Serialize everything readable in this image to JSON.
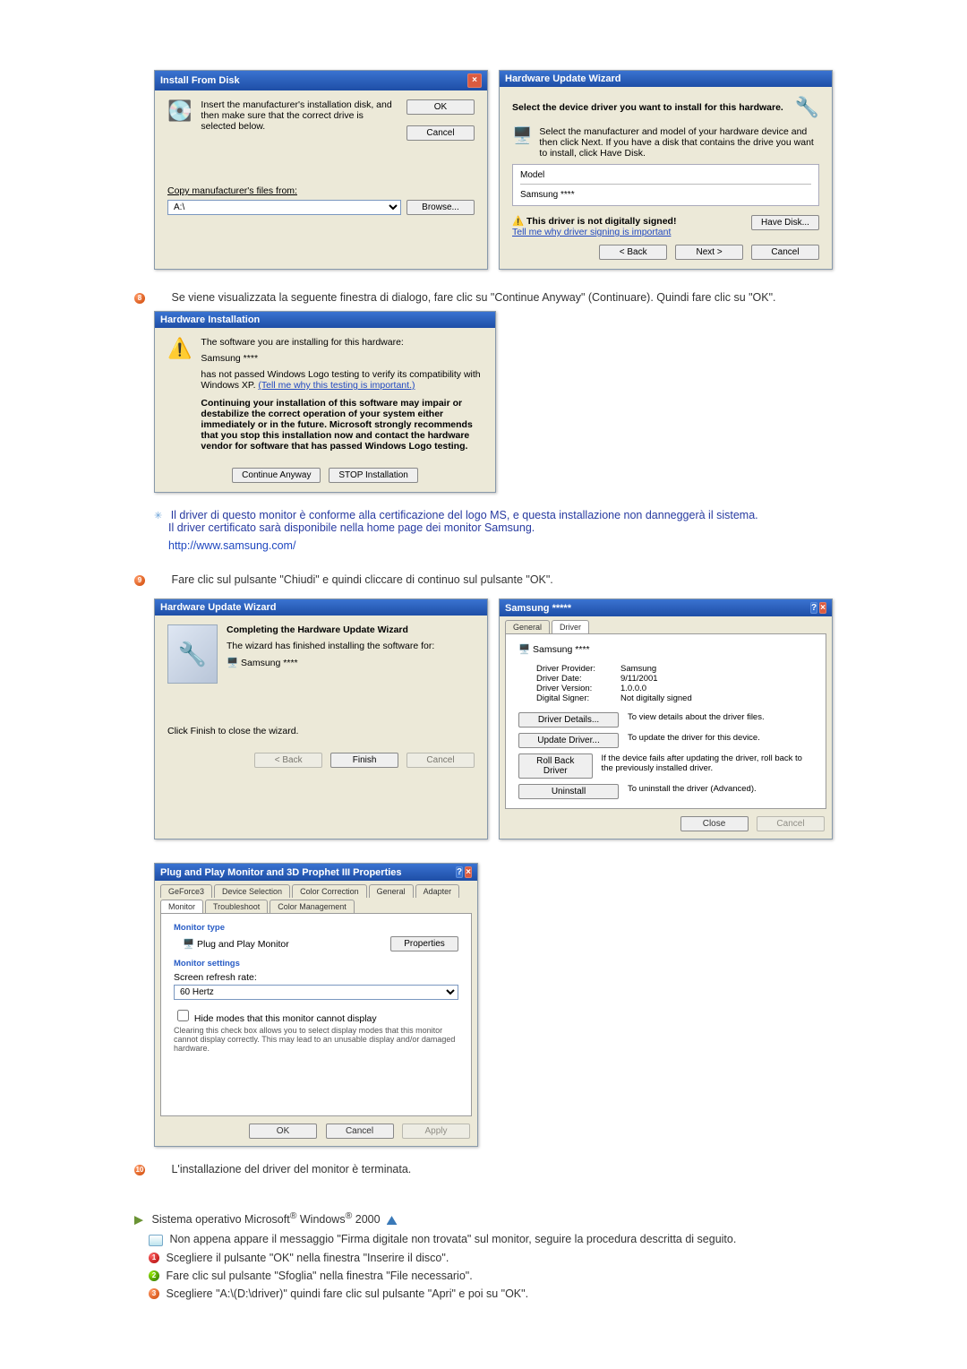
{
  "win_install_from_disk": {
    "title": "Install From Disk",
    "instruction": "Insert the manufacturer's installation disk, and then make sure that the correct drive is selected below.",
    "ok": "OK",
    "cancel": "Cancel",
    "copy_from": "Copy manufacturer's files from:",
    "path": "A:\\",
    "browse": "Browse..."
  },
  "win_hw_update": {
    "title": "Hardware Update Wizard",
    "heading": "Select the device driver you want to install for this hardware.",
    "hint": "Select the manufacturer and model of your hardware device and then click Next. If you have a disk that contains the drive you want to install, click Have Disk.",
    "model_label": "Model",
    "model_value": "Samsung ****",
    "warn": "This driver is not digitally signed!",
    "warn_link": "Tell me why driver signing is important",
    "have_disk": "Have Disk...",
    "back": "< Back",
    "next": "Next >",
    "cancel": "Cancel"
  },
  "step8": "Se viene visualizzata la seguente finestra di dialogo, fare clic su \"Continue Anyway\" (Continuare). Quindi fare clic su \"OK\".",
  "win_hw_install": {
    "title": "Hardware Installation",
    "line1": "The software you are installing for this hardware:",
    "device": "Samsung ****",
    "line2": "has not passed Windows Logo testing to verify its compatibility with Windows XP.",
    "line2_link": "(Tell me why this testing is important.)",
    "bold": "Continuing your installation of this software may impair or destabilize the correct operation of your system either immediately or in the future. Microsoft strongly recommends that you stop this installation now and contact the hardware vendor for software that has passed Windows Logo testing.",
    "cont": "Continue Anyway",
    "stop": "STOP Installation"
  },
  "driver_note1": "Il driver di questo monitor è conforme alla certificazione del logo MS, e questa installazione non danneggerà il sistema.",
  "driver_note2": "Il driver certificato sarà disponibile nella home page dei monitor Samsung.",
  "samsung_url": "http://www.samsung.com/",
  "step9": "Fare clic sul pulsante \"Chiudi\" e quindi cliccare di continuo sul pulsante \"OK\".",
  "win_completing": {
    "title": "Hardware Update Wizard",
    "heading": "Completing the Hardware Update Wizard",
    "sub": "The wizard has finished installing the software for:",
    "device": "Samsung ****",
    "footer": "Click Finish to close the wizard.",
    "back": "< Back",
    "finish": "Finish",
    "cancel": "Cancel"
  },
  "win_props": {
    "title": "Samsung *****",
    "tab_general": "General",
    "tab_driver": "Driver",
    "device": "Samsung ****",
    "provider_l": "Driver Provider:",
    "provider_v": "Samsung",
    "date_l": "Driver Date:",
    "date_v": "9/11/2001",
    "version_l": "Driver Version:",
    "version_v": "1.0.0.0",
    "signer_l": "Digital Signer:",
    "signer_v": "Not digitally signed",
    "btn_details": "Driver Details...",
    "desc_details": "To view details about the driver files.",
    "btn_update": "Update Driver...",
    "desc_update": "To update the driver for this device.",
    "btn_rollback": "Roll Back Driver",
    "desc_rollback": "If the device fails after updating the driver, roll back to the previously installed driver.",
    "btn_uninst": "Uninstall",
    "desc_uninst": "To uninstall the driver (Advanced).",
    "close": "Close",
    "cancel": "Cancel"
  },
  "win_monitor": {
    "title": "Plug and Play Monitor and 3D Prophet III Properties",
    "tab_geforce": "GeForce3",
    "tab_devsel": "Device Selection",
    "tab_colorcorr": "Color Correction",
    "tab_general": "General",
    "tab_adapter": "Adapter",
    "tab_monitor": "Monitor",
    "tab_trouble": "Troubleshoot",
    "tab_colormgmt": "Color Management",
    "sec_type": "Monitor type",
    "type_value": "Plug and Play Monitor",
    "properties": "Properties",
    "sec_settings": "Monitor settings",
    "refresh_l": "Screen refresh rate:",
    "refresh_v": "60 Hertz",
    "hide": "Hide modes that this monitor cannot display",
    "hide_desc": "Clearing this check box allows you to select display modes that this monitor cannot display correctly. This may lead to an unusable display and/or damaged hardware.",
    "ok": "OK",
    "cancel": "Cancel",
    "apply": "Apply"
  },
  "step10": "L'installazione del driver del monitor è terminata.",
  "os_line": {
    "pre": "Sistema operativo Microsoft",
    "mid": " Windows",
    "post": " 2000"
  },
  "w2k_intro": "Non appena appare il messaggio \"Firma digitale non trovata\" sul monitor, seguire la procedura descritta di seguito.",
  "w2k_1": "Scegliere il pulsante \"OK\" nella finestra \"Inserire il disco\".",
  "w2k_2": "Fare clic sul pulsante \"Sfoglia\" nella finestra \"File necessario\".",
  "w2k_3": "Scegliere \"A:\\(D:\\driver)\" quindi fare clic sul pulsante \"Apri\" e poi su \"OK\"."
}
